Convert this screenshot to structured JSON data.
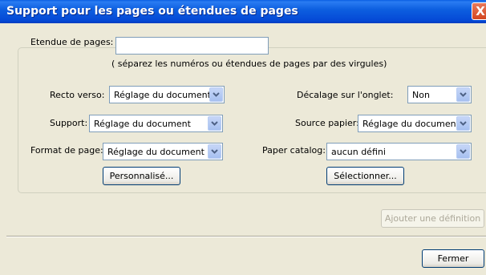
{
  "window": {
    "title": "Support pour les pages ou étendues de pages",
    "close_glyph": "X"
  },
  "page_range": {
    "label": "Etendue de pages:",
    "value": "",
    "hint": "( séparez les numéros ou étendues de pages par des virgules)"
  },
  "fields": {
    "recto_verso": {
      "label": "Recto verso:",
      "value": "Réglage du document"
    },
    "support": {
      "label": "Support:",
      "value": "Réglage du document"
    },
    "format_page": {
      "label": "Format de page:",
      "value": "Réglage du document"
    },
    "decalage": {
      "label": "Décalage sur l'onglet:",
      "value": "Non"
    },
    "source_papier": {
      "label": "Source papier:",
      "value": "Réglage du document"
    },
    "paper_catalog": {
      "label": "Paper catalog:",
      "value": "aucun défini"
    }
  },
  "buttons": {
    "personnalise": "Personnalisé...",
    "selectionner": "Sélectionner...",
    "ajouter": "Ajouter une définition",
    "fermer": "Fermer"
  },
  "colors": {
    "titlebar": "#0549d6",
    "window_bg": "#ece9d8",
    "close_button": "#d3461f"
  }
}
